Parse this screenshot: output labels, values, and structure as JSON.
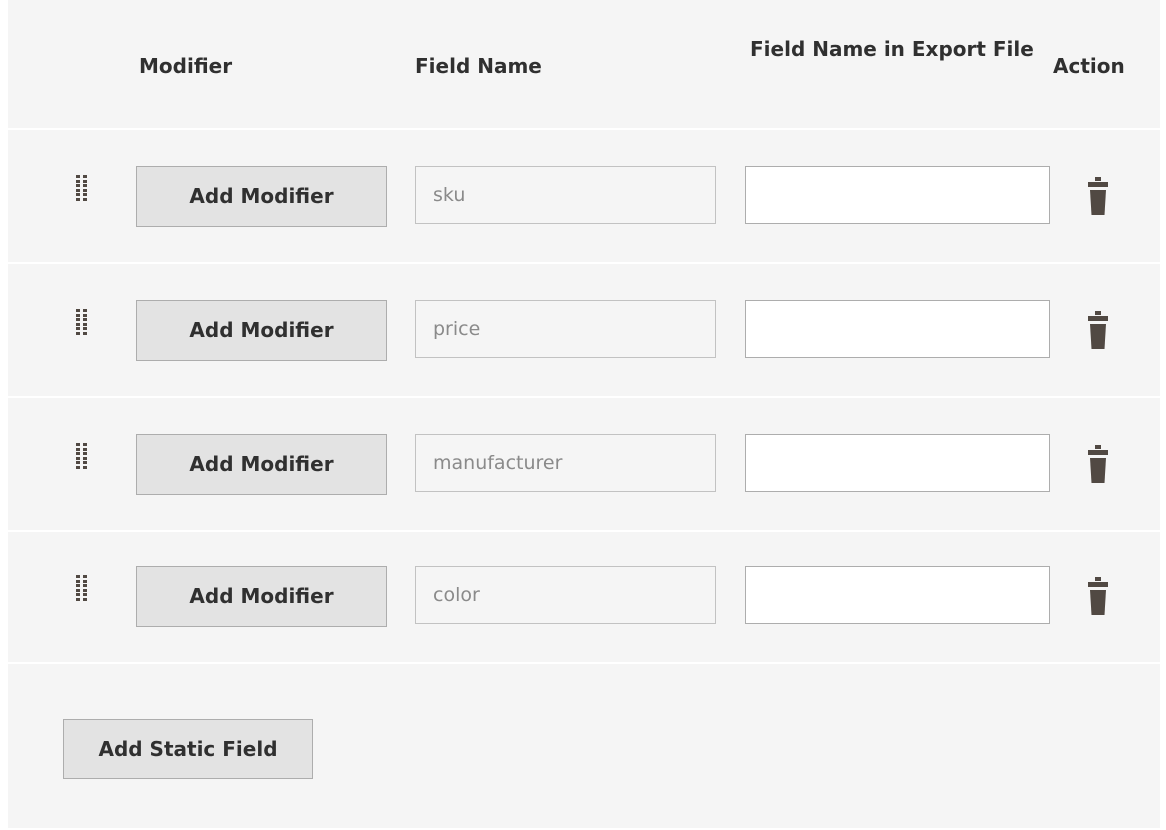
{
  "header": {
    "modifier": "Modifier",
    "field_name": "Field Name",
    "export_name": "Field Name in Export File",
    "action": "Action"
  },
  "rows": [
    {
      "modifier_label": "Add Modifier",
      "field_name": "sku",
      "export_value": ""
    },
    {
      "modifier_label": "Add Modifier",
      "field_name": "price",
      "export_value": ""
    },
    {
      "modifier_label": "Add Modifier",
      "field_name": "manufacturer",
      "export_value": ""
    },
    {
      "modifier_label": "Add Modifier",
      "field_name": "color",
      "export_value": ""
    }
  ],
  "footer": {
    "add_static_label": "Add Static Field"
  },
  "icons": {
    "drag": "drag-handle-icon",
    "delete": "trash-icon"
  },
  "colors": {
    "panel_bg": "#f5f5f5",
    "button_bg": "#e3e3e3",
    "icon": "#514943"
  }
}
